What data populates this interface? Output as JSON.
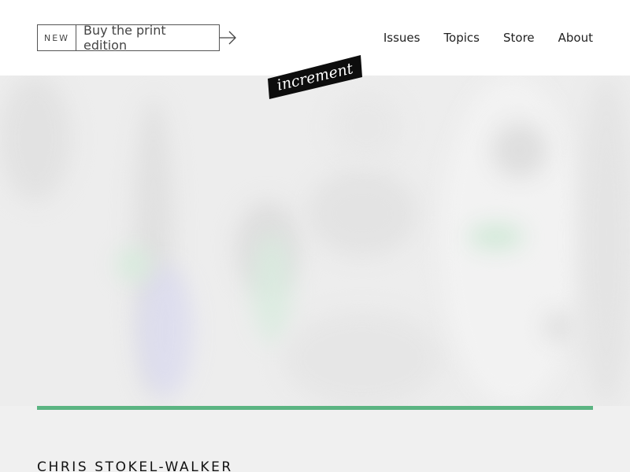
{
  "header": {
    "promo": {
      "badge": "NEW",
      "label": "Buy the print edition",
      "arrow_icon": "arrow-right-icon"
    },
    "nav": [
      {
        "label": "Issues"
      },
      {
        "label": "Topics"
      },
      {
        "label": "Store"
      },
      {
        "label": "About"
      }
    ],
    "logo_text": "increment"
  },
  "article": {
    "author": "CHRIS STOKEL-WALKER"
  },
  "colors": {
    "accent": "#5bb482",
    "logo_bg": "#0d0d0d",
    "hero_bg": "#ededed"
  }
}
